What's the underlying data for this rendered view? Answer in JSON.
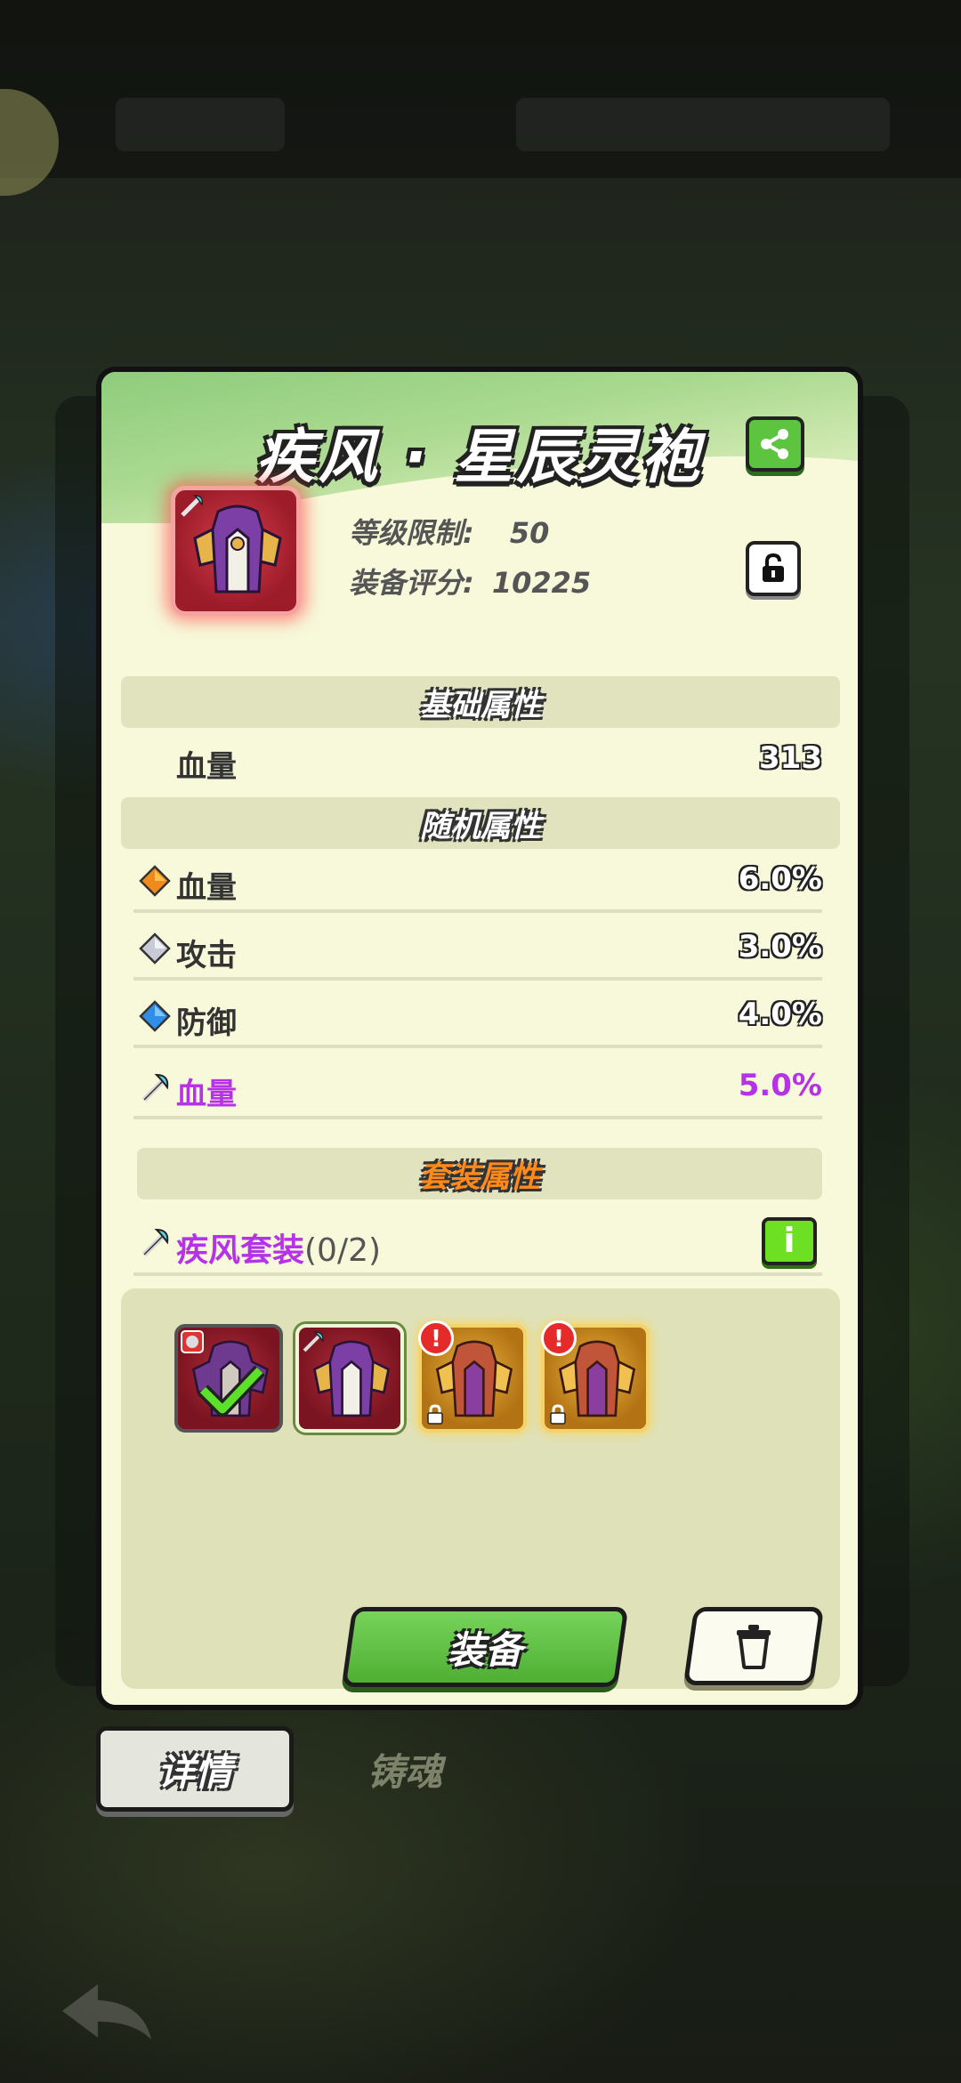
{
  "item": {
    "title": "疾风 · 星辰灵袍",
    "level_label": "等级限制:",
    "level_value": "50",
    "score_label": "装备评分:",
    "score_value": "10225"
  },
  "sections": {
    "base": "基础属性",
    "random": "随机属性",
    "set": "套装属性"
  },
  "base_stats": [
    {
      "name": "血量",
      "value": "313"
    }
  ],
  "random_stats": [
    {
      "icon": "orange-diamond-icon",
      "name": "血量",
      "value": "6.0%"
    },
    {
      "icon": "silver-diamond-icon",
      "name": "攻击",
      "value": "3.0%"
    },
    {
      "icon": "blue-diamond-icon",
      "name": "防御",
      "value": "4.0%"
    },
    {
      "icon": "wind-sword-icon",
      "name": "血量",
      "value": "5.0%"
    }
  ],
  "set_info": {
    "name": "疾风套装",
    "count": "(0/2)",
    "info_icon": "i"
  },
  "set_pieces": [
    {
      "rarity": "red",
      "state": "equipped"
    },
    {
      "rarity": "red",
      "state": "selected"
    },
    {
      "rarity": "gold",
      "state": "locked-alert"
    },
    {
      "rarity": "gold",
      "state": "locked-alert"
    }
  ],
  "buttons": {
    "equip": "装备"
  },
  "tabs": [
    {
      "label": "详情",
      "active": true
    },
    {
      "label": "铸魂",
      "active": false
    }
  ],
  "colors": {
    "accent_green": "#5cc43f",
    "set_purple": "#b532e8",
    "set_title_orange": "#ff8a1c",
    "panel_bg": "#f7f9da"
  }
}
